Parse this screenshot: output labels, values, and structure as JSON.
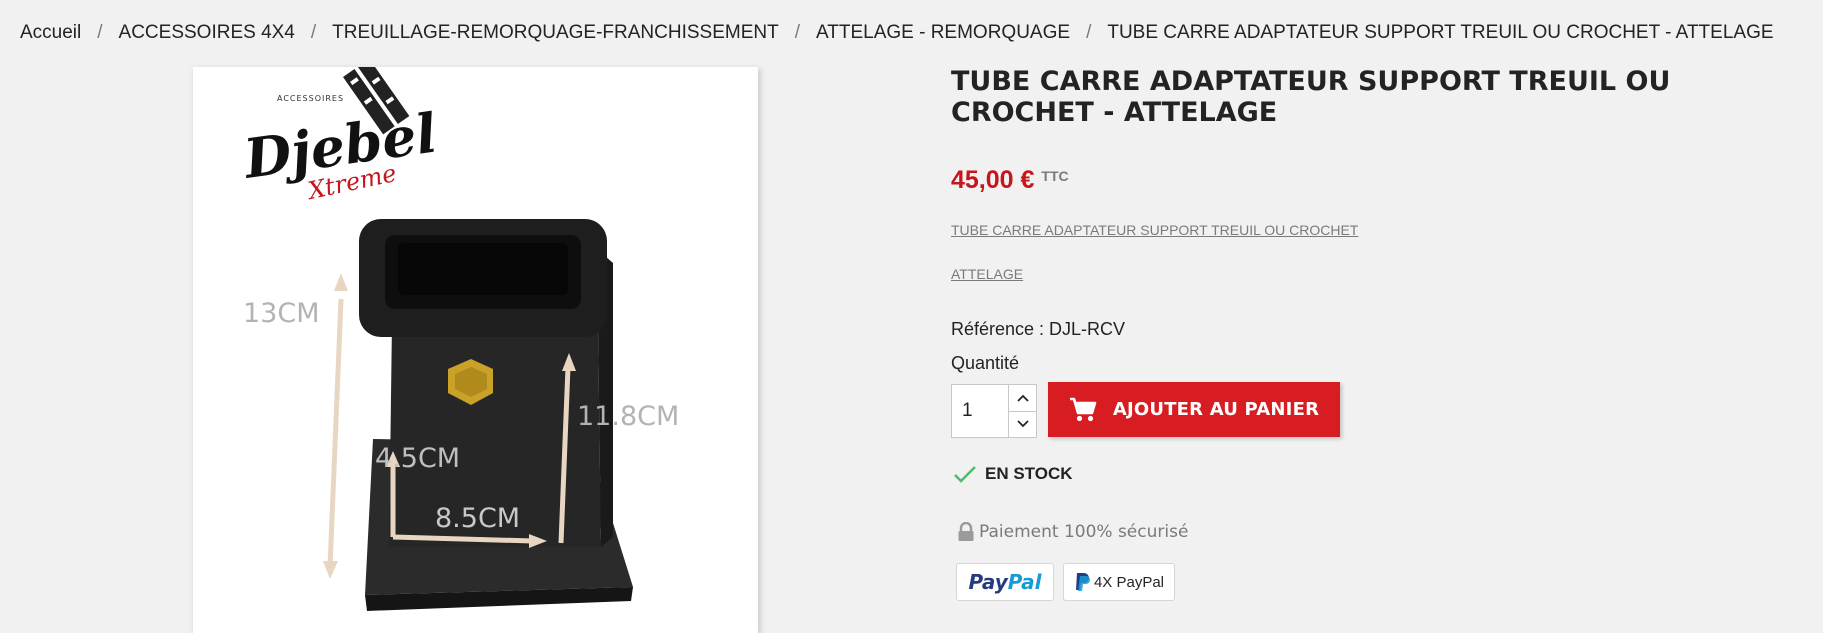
{
  "breadcrumb": {
    "items": [
      "Accueil",
      "ACCESSOIRES 4X4",
      "TREUILLAGE-REMORQUAGE-FRANCHISSEMENT",
      "ATTELAGE - REMORQUAGE",
      "TUBE CARRE ADAPTATEUR SUPPORT TREUIL OU CROCHET - ATTELAGE"
    ],
    "separator": "/"
  },
  "image": {
    "logo": {
      "top_text": "ACCESSOIRES",
      "brand": "Djebel",
      "sub": "Xtreme"
    },
    "dimensions": [
      "13CM",
      "11.8CM",
      "4.5CM",
      "8.5CM"
    ]
  },
  "product": {
    "title": "TUBE CARRE ADAPTATEUR SUPPORT TREUIL OU CROCHET - ATTELAGE",
    "price": "45,00 €",
    "tax_label": "TTC",
    "description_lines": [
      "TUBE CARRE ADAPTATEUR SUPPORT TREUIL OU CROCHET ",
      "ATTELAGE "
    ],
    "reference": "Référence : DJL-RCV",
    "quantity_label": "Quantité",
    "quantity_value": "1",
    "add_to_cart_label": "AJOUTER AU PANIER",
    "stock_label": "EN STOCK",
    "secure_payment_label": "Paiement 100% sécurisé",
    "payment_badges": {
      "paypal_pay": "Pay",
      "paypal_pal": "Pal",
      "paypal_4x": "4X PayPal"
    }
  },
  "colors": {
    "background": "#f1f1f1",
    "accent_red": "#d71d21",
    "price_red": "#c4161c",
    "stock_green": "#4cbb6c",
    "text": "#232323",
    "muted": "#7a7a7a"
  },
  "icons": [
    "cart-icon",
    "chevron-up-icon",
    "chevron-down-icon",
    "check-icon",
    "lock-icon",
    "paypal-logo-icon"
  ]
}
